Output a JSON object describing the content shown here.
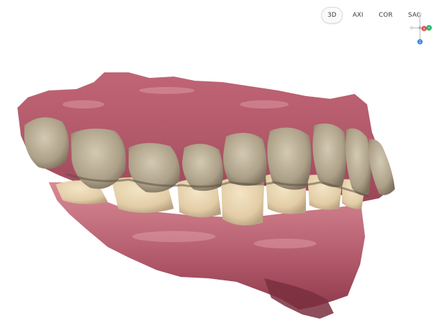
{
  "view_tabs": [
    {
      "label": "3D",
      "active": true
    },
    {
      "label": "AXI",
      "active": false
    },
    {
      "label": "COR",
      "active": false
    },
    {
      "label": "SAG",
      "active": false
    }
  ],
  "gizmo": {
    "x_label": "X",
    "y_label": "Y",
    "z_label": "Z",
    "colors": {
      "x": "#e5484d",
      "y": "#2fb866",
      "z": "#3b82e0",
      "neutral": "#c9ccd2"
    }
  },
  "scene": {
    "subject": "3d-dental-scan",
    "colors": {
      "gum": "#b2596a",
      "gum_light": "#d98a96",
      "gum_dark": "#7a2f3e",
      "upper_teeth": "#b9ad94",
      "lower_teeth": "#e3cfab",
      "shadow": "#6f6454"
    }
  }
}
